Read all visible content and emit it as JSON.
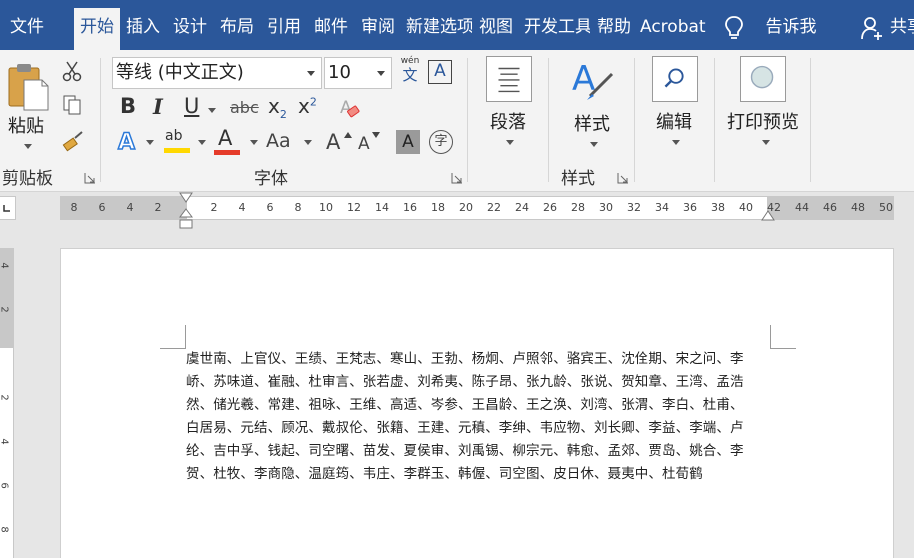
{
  "tabs": [
    {
      "label": "文件",
      "active": false
    },
    {
      "label": "开始",
      "active": true
    },
    {
      "label": "插入",
      "active": false
    },
    {
      "label": "设计",
      "active": false
    },
    {
      "label": "布局",
      "active": false
    },
    {
      "label": "引用",
      "active": false
    },
    {
      "label": "邮件",
      "active": false
    },
    {
      "label": "审阅",
      "active": false
    },
    {
      "label": "新建选项",
      "active": false
    },
    {
      "label": "视图",
      "active": false
    },
    {
      "label": "开发工具",
      "active": false
    },
    {
      "label": "帮助",
      "active": false
    },
    {
      "label": "Acrobat",
      "active": false
    }
  ],
  "tell_me": "告诉我",
  "share": "共享",
  "clipboard": {
    "paste_label": "粘贴",
    "group_label": "剪贴板"
  },
  "font": {
    "font_name": "等线 (中文正文)",
    "font_size": "10",
    "phonetic_top": "wén",
    "phonetic_bottom": "文",
    "bold": "B",
    "italic": "I",
    "underline": "U",
    "strikethrough": "abc",
    "subscript": "x",
    "subscript_mark": "2",
    "superscript": "x",
    "superscript_mark": "2",
    "text_effect": "A",
    "highlight": "ab",
    "font_color": "A",
    "change_case": "Aa",
    "grow_font": "A",
    "shrink_font": "A",
    "char_shading": "A",
    "enclose_char": "字",
    "group_label": "字体"
  },
  "paragraph": {
    "label": "段落"
  },
  "styles": {
    "label": "样式",
    "group_label": "样式"
  },
  "editing": {
    "label": "编辑"
  },
  "print_preview": {
    "label": "打印预览"
  },
  "colors": {
    "accent": "#2b579a",
    "highlight": "#ffd800",
    "font_color": "#e53b2a"
  },
  "ruler": {
    "labels": [
      "8",
      "6",
      "4",
      "2",
      "",
      "2",
      "4",
      "6",
      "8",
      "10",
      "12",
      "14",
      "16",
      "18",
      "20",
      "22",
      "24",
      "26",
      "28",
      "30",
      "32",
      "34",
      "36",
      "38",
      "40",
      "42",
      "44",
      "46",
      "48",
      "50"
    ]
  },
  "vruler": {
    "labels": [
      "4",
      "2",
      "",
      "2",
      "4",
      "6",
      "8"
    ]
  },
  "document": {
    "lines": [
      "虞世南、上官仪、王绩、王梵志、寒山、王勃、杨炯、卢照邻、骆宾王、沈佺期、宋之问、李",
      "峤、苏味道、崔融、杜审言、张若虚、刘希夷、陈子昂、张九龄、张说、贺知章、王湾、孟浩",
      "然、储光羲、常建、祖咏、王维、高适、岑参、王昌龄、王之涣、刘湾、张渭、李白、杜甫、",
      "白居易、元结、顾况、戴叔伦、张籍、王建、元稹、李绅、韦应物、刘长卿、李益、李端、卢",
      "纶、吉中孚、钱起、司空曙、苗发、夏侯审、刘禹锡、柳宗元、韩愈、孟郊、贾岛、姚合、李",
      "贺、杜牧、李商隐、温庭筠、韦庄、李群玉、韩偓、司空图、皮日休、聂夷中、杜荀鹤"
    ]
  }
}
